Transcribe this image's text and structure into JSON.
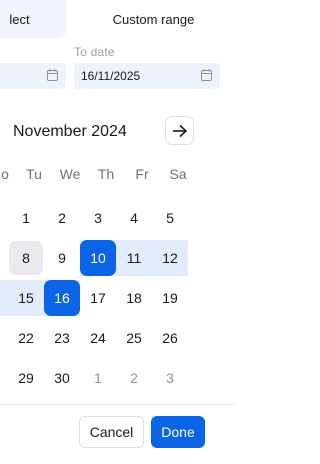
{
  "tabs": {
    "select_label": "lect",
    "custom_label": "Custom range"
  },
  "to_date": {
    "label": "To  date",
    "value": "16/11/2025"
  },
  "calendar": {
    "month_title": "November 2024",
    "weekdays": [
      "o",
      "Tu",
      "We",
      "Th",
      "Fr",
      "Sa"
    ],
    "rows": [
      [
        "",
        "1",
        "2",
        "3",
        "4",
        "5"
      ],
      [
        "",
        "8",
        "9",
        "10",
        "11",
        "12"
      ],
      [
        "15",
        "16",
        "17",
        "18",
        "19"
      ],
      [
        "22",
        "23",
        "24",
        "25",
        "26"
      ],
      [
        "29",
        "30",
        "1",
        "2",
        "3"
      ]
    ],
    "today": "8",
    "range_start": "10",
    "range_end": "16"
  },
  "footer": {
    "cancel_label": "Cancel",
    "done_label": "Done"
  },
  "colors": {
    "accent": "#0b63e5",
    "range_fill": "#e3ecfa"
  },
  "icons": {
    "next": "arrow-right-icon",
    "calendar": "calendar-icon"
  }
}
